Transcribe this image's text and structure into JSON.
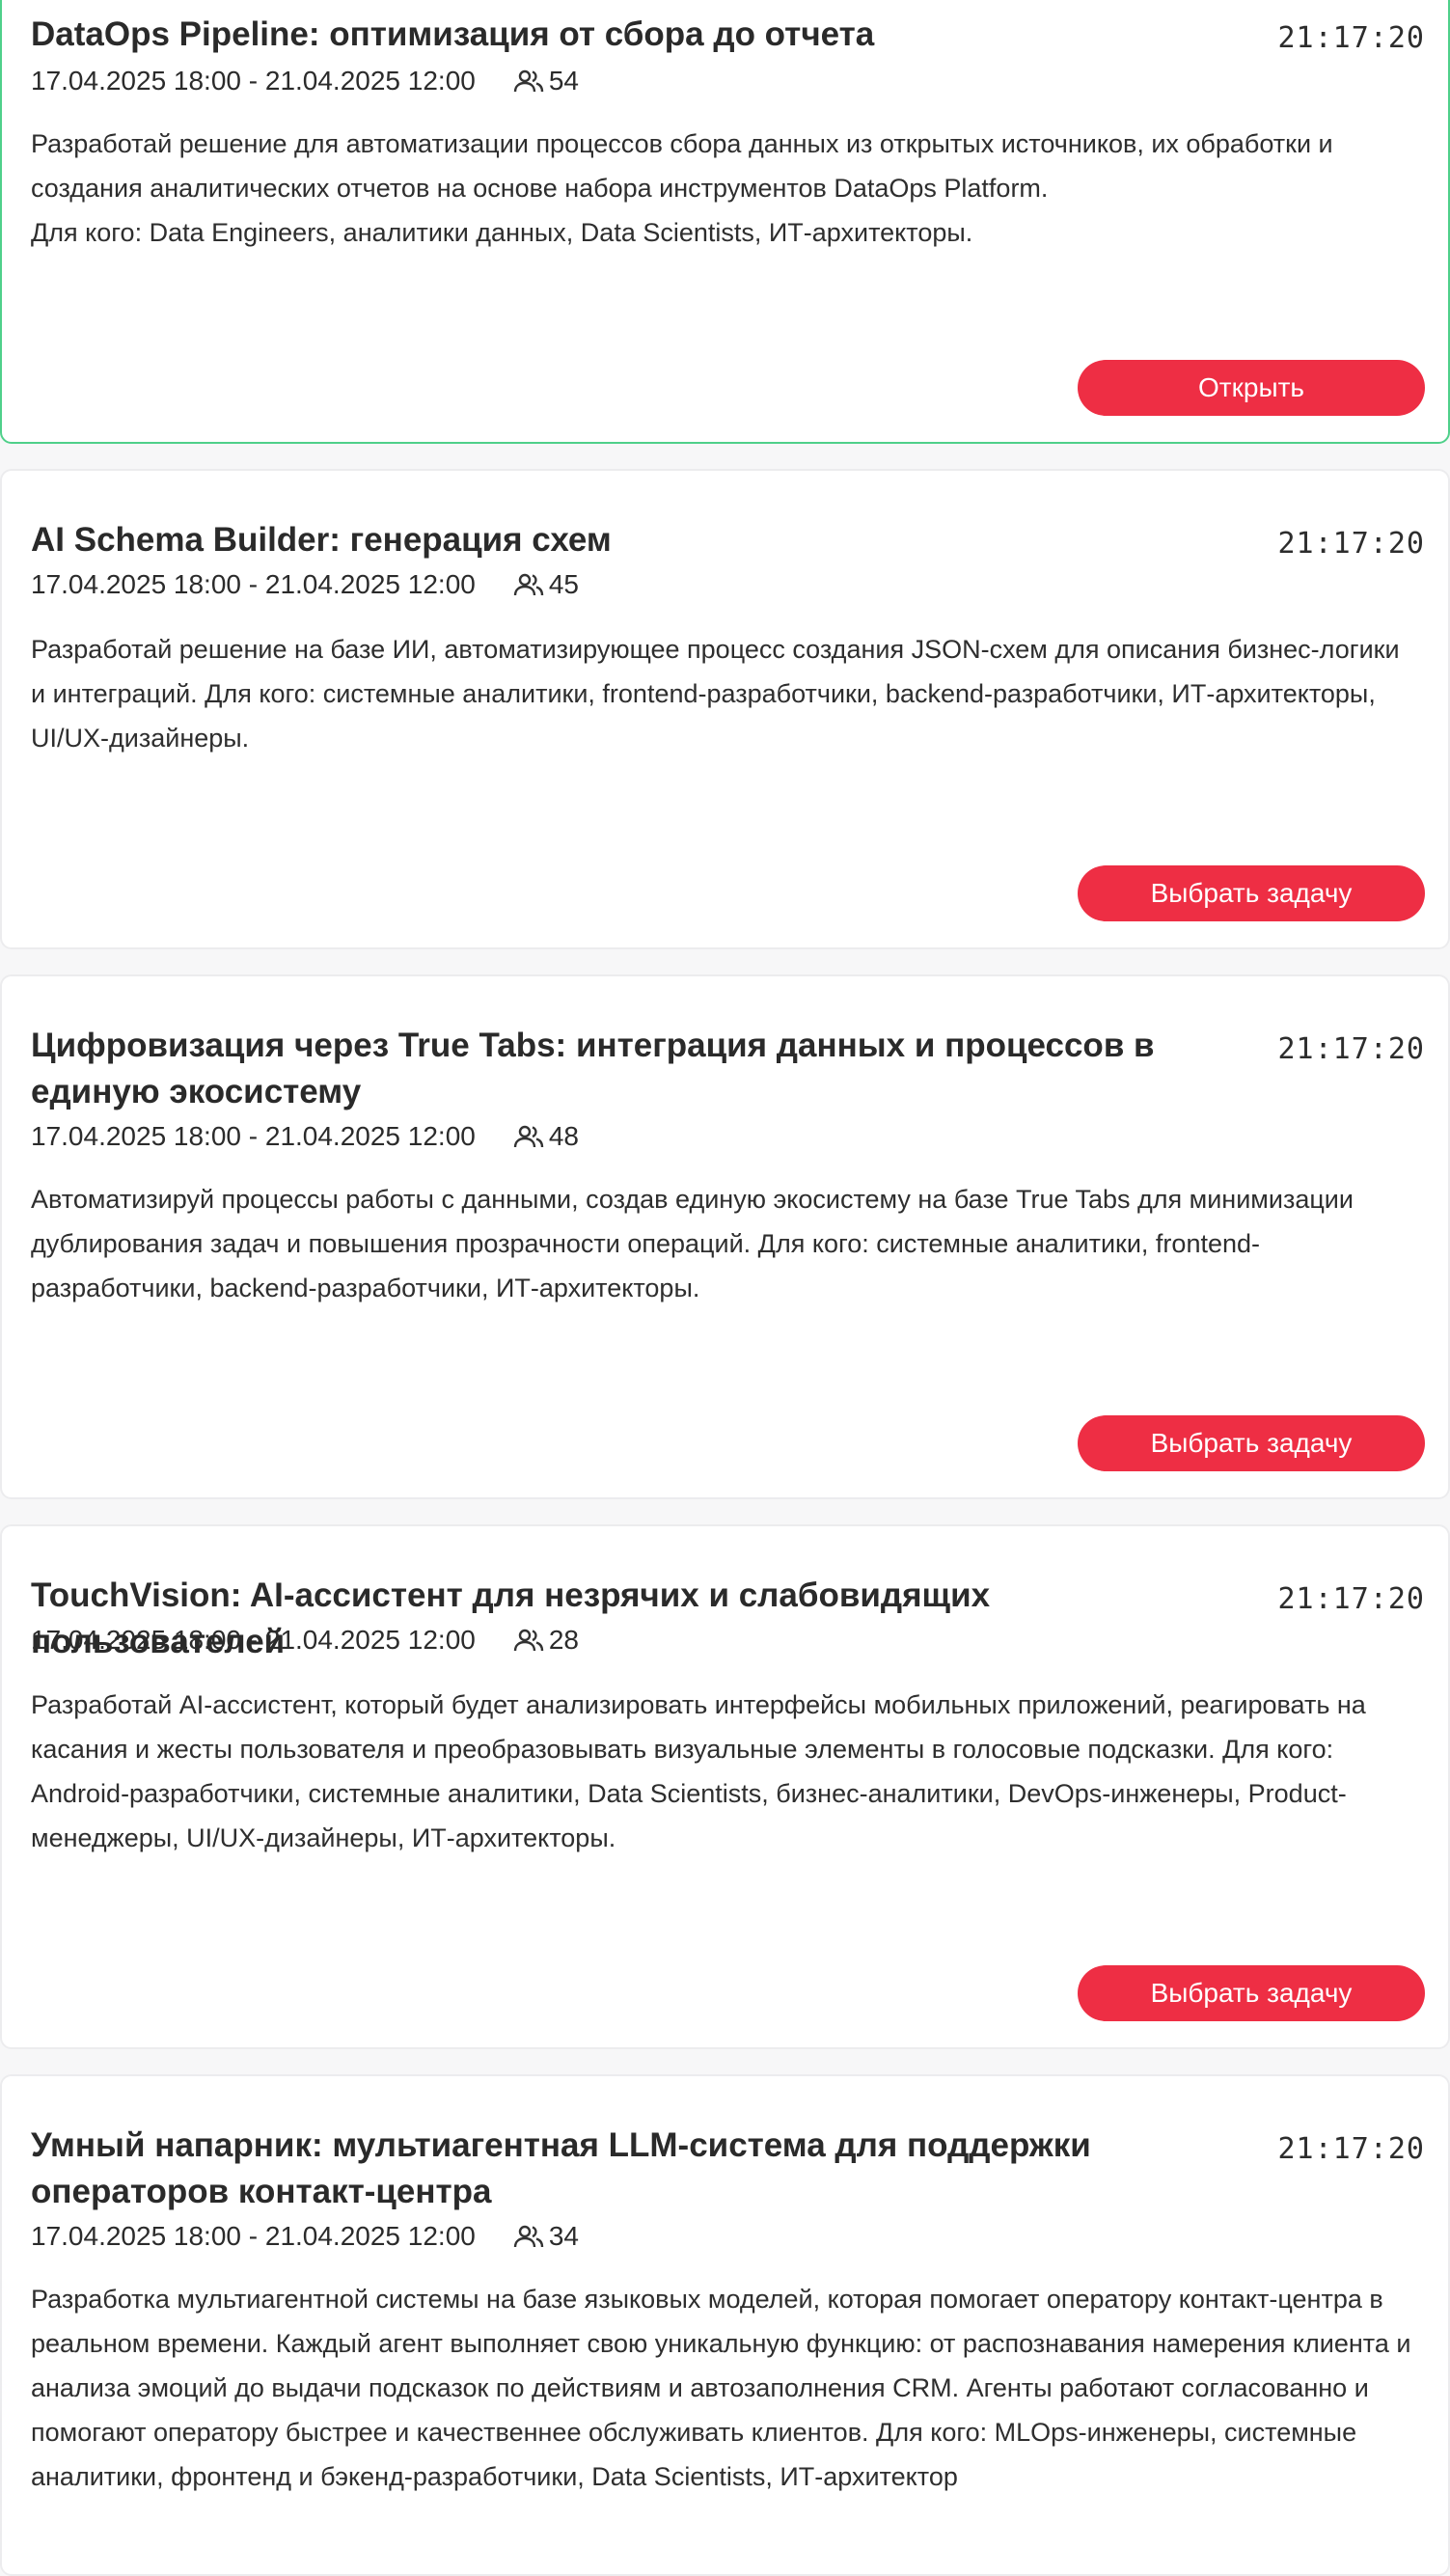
{
  "accent_color": "#ee2e44",
  "active_border_color": "#4fd08a",
  "icons": {
    "participants": "people-icon"
  },
  "cards": [
    {
      "title": "DataOps Pipeline: оптимизация от сбора до отчета",
      "time": "21:17:20",
      "dates": "17.04.2025 18:00 - 21.04.2025 12:00",
      "participants": "54",
      "description": "Разработай решение для автоматизации процессов сбора данных из открытых источников, их обработки и создания аналитических отчетов на основе набора инструментов DataOps Platform.\nДля кого: Data Engineers, аналитики данных, Data Scientists, ИТ-архитекторы.",
      "button": "Открыть",
      "active": true
    },
    {
      "title": "AI Schema Builder: генерация схем",
      "time": "21:17:20",
      "dates": "17.04.2025 18:00 - 21.04.2025 12:00",
      "participants": "45",
      "description": "Разработай решение на базе ИИ, автоматизирующее процесс создания JSON-схем для описания бизнес-логики и интеграций. Для кого: системные аналитики, frontend-разработчики, backend-разработчики, ИТ-архитекторы, UI/UX-дизайнеры.",
      "button": "Выбрать задачу",
      "active": false
    },
    {
      "title": "Цифровизация через True Tabs: интеграция данных и процессов в единую экосистему",
      "time": "21:17:20",
      "dates": "17.04.2025 18:00 - 21.04.2025 12:00",
      "participants": "48",
      "description": "Автоматизируй процессы работы с данными, создав единую экосистему на базе True Tabs для минимизации дублирования задач и повышения прозрачности операций. Для кого: системные аналитики, frontend-разработчики, backend-разработчики, ИТ-архитекторы.",
      "button": "Выбрать задачу",
      "active": false
    },
    {
      "title": "TouchVision: AI-ассистент для незрячих и слабовидящих пользователей",
      "time": "21:17:20",
      "dates": "17.04.2025 18:00 - 21.04.2025 12:00",
      "participants": "28",
      "description": "Разработай AI-ассистент, который будет анализировать интерфейсы мобильных приложений, реагировать на касания и жесты пользователя и преобразовывать визуальные элементы в голосовые подсказки. Для кого: Android-разработчики, системные аналитики, Data Scientists, бизнес-аналитики, DevOps-инженеры, Product-менеджеры, UI/UX-дизайнеры, ИТ-архитекторы.",
      "button": "Выбрать задачу",
      "active": false
    },
    {
      "title": "Умный напарник: мультиагентная LLM-система для поддержки операторов контакт-центра",
      "time": "21:17:20",
      "dates": "17.04.2025 18:00 - 21.04.2025 12:00",
      "participants": "34",
      "description": "Разработка мультиагентной системы на базе языковых моделей, которая помогает оператору контакт-центра в реальном времени. Каждый агент выполняет свою уникальную функцию: от распознавания намерения клиента и анализа эмоций до выдачи подсказок по действиям и автозаполнения CRM. Агенты работают согласованно и помогают оператору быстрее и качественнее обслуживать клиентов. Для кого: MLOps-инженеры, системные аналитики, фронтенд и бэкенд-разработчики, Data Scientists, ИТ-архитектор",
      "button": "",
      "active": false
    }
  ]
}
